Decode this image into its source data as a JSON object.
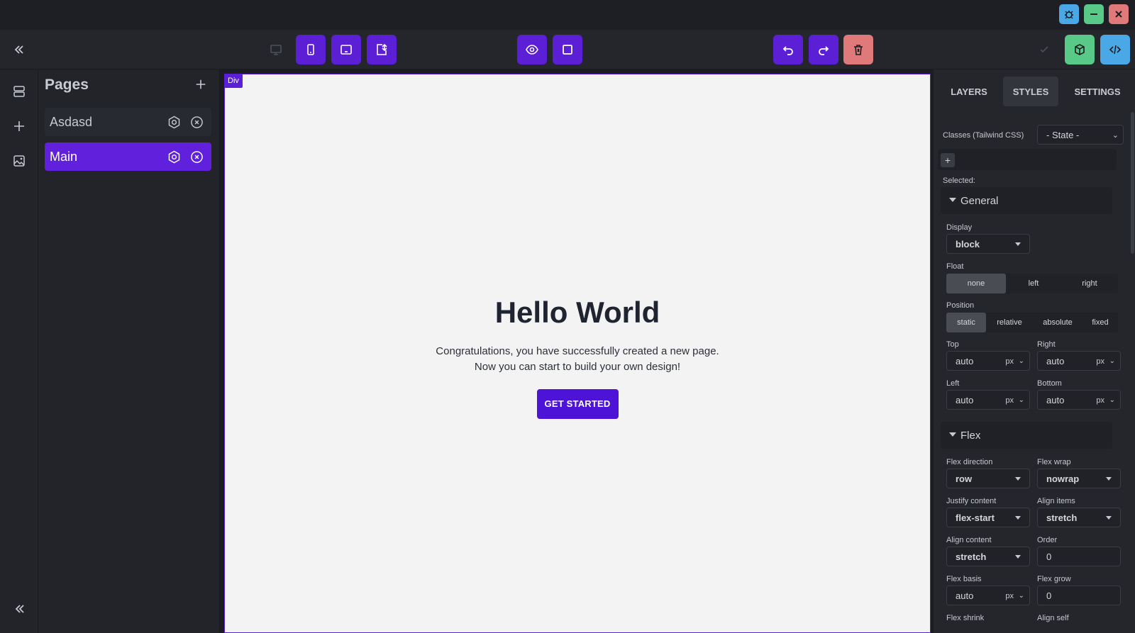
{
  "toolbar": {
    "colors": {
      "accent": "#5b1fd6",
      "delete": "#e07a7a",
      "publish": "#59c987",
      "code": "#4aa8e6"
    }
  },
  "pages_panel": {
    "title": "Pages",
    "items": [
      {
        "label": "Asdasd",
        "active": false
      },
      {
        "label": "Main",
        "active": true
      }
    ]
  },
  "canvas": {
    "selected_badge": "Div",
    "heading": "Hello World",
    "line1": "Congratulations, you have successfully created a new page.",
    "line2": "Now you can start to build your own design!",
    "cta_label": "GET STARTED"
  },
  "right_panel": {
    "tabs": [
      "LAYERS",
      "STYLES",
      "SETTINGS"
    ],
    "active_tab": "STYLES",
    "classes_label": "Classes (Tailwind CSS)",
    "state_select": "- State -",
    "selected_label": "Selected:",
    "general": {
      "title": "General",
      "display_label": "Display",
      "display_value": "block",
      "float_label": "Float",
      "float_options": [
        "none",
        "left",
        "right"
      ],
      "float_selected": "none",
      "position_label": "Position",
      "position_options": [
        "static",
        "relative",
        "absolute",
        "fixed"
      ],
      "position_selected": "static",
      "top_label": "Top",
      "top_value": "auto",
      "top_unit": "px",
      "right_label": "Right",
      "right_value": "auto",
      "right_unit": "px",
      "left_label": "Left",
      "left_value": "auto",
      "left_unit": "px",
      "bottom_label": "Bottom",
      "bottom_value": "auto",
      "bottom_unit": "px"
    },
    "flex": {
      "title": "Flex",
      "direction_label": "Flex direction",
      "direction_value": "row",
      "wrap_label": "Flex wrap",
      "wrap_value": "nowrap",
      "justify_label": "Justify content",
      "justify_value": "flex-start",
      "align_items_label": "Align items",
      "align_items_value": "stretch",
      "align_content_label": "Align content",
      "align_content_value": "stretch",
      "order_label": "Order",
      "order_value": "0",
      "basis_label": "Flex basis",
      "basis_value": "auto",
      "basis_unit": "px",
      "grow_label": "Flex grow",
      "grow_value": "0",
      "shrink_label": "Flex shrink",
      "align_self_label": "Align self"
    }
  }
}
